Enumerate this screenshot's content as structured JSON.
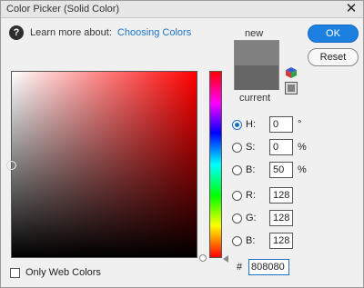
{
  "window": {
    "title": "Color Picker (Solid Color)",
    "close_glyph": "✕"
  },
  "help": {
    "icon_glyph": "?",
    "label": "Learn more about:",
    "link_text": "Choosing Colors"
  },
  "swatches": {
    "new_label": "new",
    "current_label": "current",
    "new_color": "#808080",
    "current_color": "#666666"
  },
  "buttons": {
    "ok_label": "OK",
    "reset_label": "Reset"
  },
  "hsb": {
    "h": {
      "label": "H:",
      "value": "0",
      "unit": "°",
      "selected": true
    },
    "s": {
      "label": "S:",
      "value": "0",
      "unit": "%",
      "selected": false
    },
    "b": {
      "label": "B:",
      "value": "50",
      "unit": "%",
      "selected": false
    }
  },
  "rgb": {
    "r": {
      "label": "R:",
      "value": "128"
    },
    "g": {
      "label": "G:",
      "value": "128"
    },
    "b": {
      "label": "B:",
      "value": "128"
    }
  },
  "hex": {
    "hash": "#",
    "value": "808080"
  },
  "web_only": {
    "label": "Only Web Colors",
    "checked": false
  },
  "colors": {
    "accent": "#1d7fe0",
    "link": "#1a73c7"
  }
}
